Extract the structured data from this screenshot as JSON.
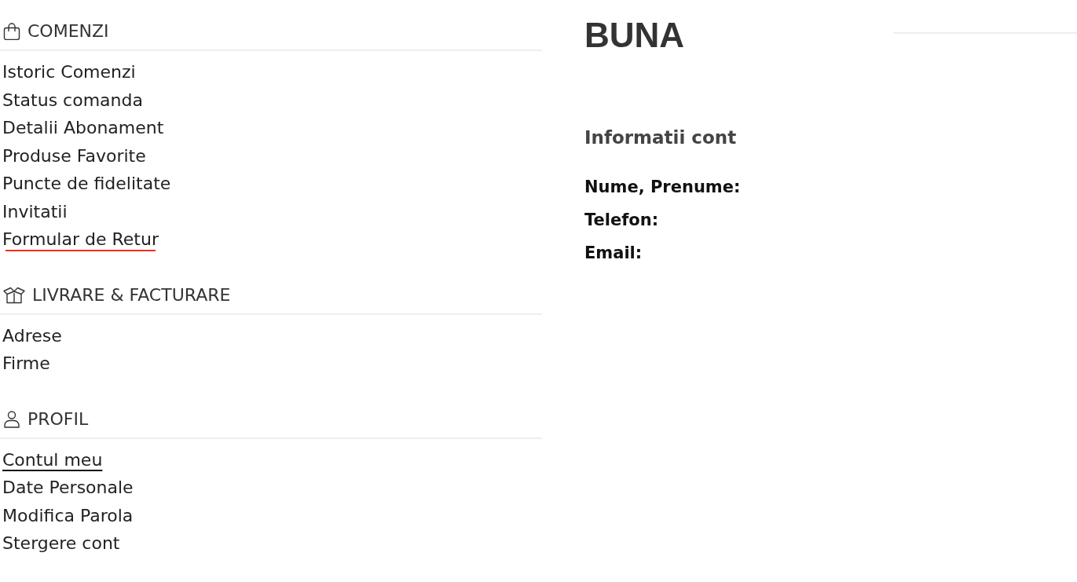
{
  "sections": [
    {
      "title": "COMENZI",
      "items": [
        {
          "label": "Istoric Comenzi",
          "selected": false,
          "hovered": false
        },
        {
          "label": "Status comanda",
          "selected": false,
          "hovered": false
        },
        {
          "label": "Detalii Abonament",
          "selected": false,
          "hovered": false
        },
        {
          "label": "Produse Favorite",
          "selected": false,
          "hovered": false
        },
        {
          "label": "Puncte de fidelitate",
          "selected": false,
          "hovered": false
        },
        {
          "label": "Invitatii",
          "selected": false,
          "hovered": false
        },
        {
          "label": "Formular de Retur",
          "selected": false,
          "hovered": true
        }
      ]
    },
    {
      "title": "LIVRARE & FACTURARE",
      "items": [
        {
          "label": "Adrese",
          "selected": false,
          "hovered": false
        },
        {
          "label": "Firme",
          "selected": false,
          "hovered": false
        }
      ]
    },
    {
      "title": "PROFIL",
      "items": [
        {
          "label": "Contul meu",
          "selected": true,
          "hovered": false
        },
        {
          "label": "Date Personale",
          "selected": false,
          "hovered": false
        },
        {
          "label": "Modifica Parola",
          "selected": false,
          "hovered": false
        },
        {
          "label": "Stergere cont",
          "selected": false,
          "hovered": false
        }
      ]
    }
  ],
  "greeting": "BUNA",
  "account_info": {
    "title": "Informatii cont",
    "fields": [
      "Nume, Prenume:",
      "Telefon:",
      "Email:"
    ]
  }
}
